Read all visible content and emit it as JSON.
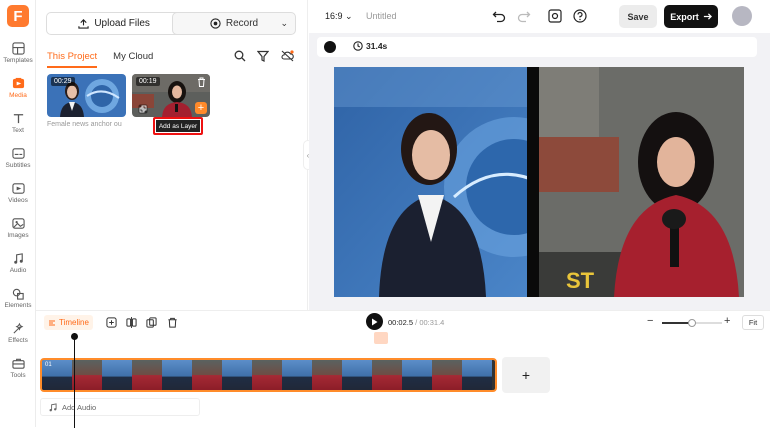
{
  "app": {
    "logo_letter": "F"
  },
  "rail": {
    "items": [
      {
        "label": "Templates",
        "icon": "templates-icon",
        "active": false
      },
      {
        "label": "Media",
        "icon": "media-icon",
        "active": true
      },
      {
        "label": "Text",
        "icon": "text-icon",
        "active": false
      },
      {
        "label": "Subtitles",
        "icon": "subtitles-icon",
        "active": false
      },
      {
        "label": "Videos",
        "icon": "videos-icon",
        "active": false
      },
      {
        "label": "Images",
        "icon": "images-icon",
        "active": false
      },
      {
        "label": "Audio",
        "icon": "audio-icon",
        "active": false
      },
      {
        "label": "Elements",
        "icon": "elements-icon",
        "active": false
      },
      {
        "label": "Effects",
        "icon": "effects-icon",
        "active": false
      },
      {
        "label": "Tools",
        "icon": "tools-icon",
        "active": false
      }
    ]
  },
  "media": {
    "upload_label": "Upload Files",
    "record_label": "Record",
    "tabs": [
      "This Project",
      "My Cloud"
    ],
    "clips": [
      {
        "duration": "00:29"
      },
      {
        "duration": "00:19"
      }
    ],
    "caption": "Female news anchor ou",
    "tooltip": "Add as Layer"
  },
  "topbar": {
    "ratio": "16:9",
    "title": "Untitled",
    "save_label": "Save",
    "export_label": "Export"
  },
  "canvas_toolbar": {
    "duration": "31.4s"
  },
  "timeline": {
    "label": "Timeline",
    "current_time": "00:02.5",
    "separator": "/",
    "total_time": "00:31.4",
    "fit_label": "Fit",
    "add_audio_label": "Add Audio",
    "track_label": "01",
    "zoom_level": 0.5
  },
  "colors": {
    "accent": "#ff6b1a",
    "export_bg": "#111111",
    "highlight_border": "#e11111"
  }
}
